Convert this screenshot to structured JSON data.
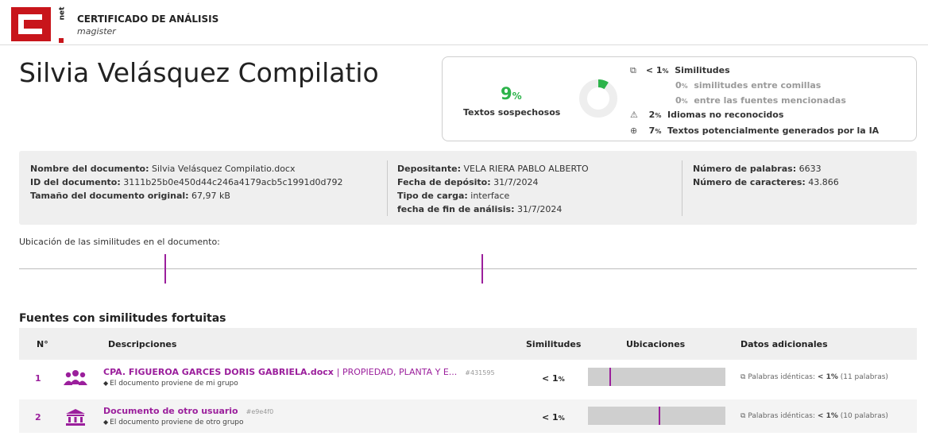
{
  "header": {
    "logo_text": "net",
    "title": "CERTIFICADO DE ANÁLISIS",
    "subtitle": "magister"
  },
  "author": "Silvia Velásquez Compilatio",
  "summary": {
    "suspicious_value": "9",
    "suspicious_unit": "%",
    "suspicious_label": "Textos sospechosos",
    "donut_fraction": 0.09,
    "donut_color": "#2cb34a",
    "rows": [
      {
        "icon": "copy-icon",
        "value": "< 1",
        "unit": "%",
        "label": "Similitudes"
      },
      {
        "icon": "",
        "value": "0",
        "unit": "%",
        "label": "similitudes entre comillas"
      },
      {
        "icon": "",
        "value": "0",
        "unit": "%",
        "label": "entre las fuentes mencionadas"
      },
      {
        "icon": "warning-icon",
        "value": "2",
        "unit": "%",
        "label": "Idiomas no reconocidos"
      },
      {
        "icon": "ai-icon",
        "value": "7",
        "unit": "%",
        "label": "Textos potencialmente generados por la IA"
      }
    ]
  },
  "document_info": {
    "col1": [
      {
        "label": "Nombre del documento:",
        "value": "Silvia Velásquez Compilatio.docx"
      },
      {
        "label": "ID del documento:",
        "value": "3111b25b0e450d44c246a4179acb5c1991d0d792"
      },
      {
        "label": "Tamaño del documento original:",
        "value": "67,97 kB"
      }
    ],
    "col2": [
      {
        "label": "Depositante:",
        "value": "VELA RIERA PABLO ALBERTO"
      },
      {
        "label": "Fecha de depósito:",
        "value": "31/7/2024"
      },
      {
        "label": "Tipo de carga:",
        "value": "interface"
      },
      {
        "label": "fecha de fin de análisis:",
        "value": "31/7/2024"
      }
    ],
    "col3": [
      {
        "label": "Número de palabras:",
        "value": "6633"
      },
      {
        "label": "Número de caracteres:",
        "value": "43.866"
      }
    ]
  },
  "location": {
    "title": "Ubicación de las similitudes en el documento:",
    "accent": "#9b1f9c"
  },
  "sources": {
    "title": "Fuentes con similitudes fortuitas",
    "headers": {
      "num": "N°",
      "desc": "Descripciones",
      "sim": "Similitudes",
      "loc": "Ubicaciones",
      "extra": "Datos adicionales"
    },
    "rows": [
      {
        "num": "1",
        "icon": "group-icon",
        "title": "CPA. FIGUEROA GARCES DORIS GABRIELA.docx",
        "title_extra": "| PROPIEDAD, PLANTA Y E...",
        "hash": "#431595",
        "sub": "El documento proviene de mi grupo",
        "sim_value": "< 1",
        "sim_unit": "%",
        "extra_label": "Palabras idénticas:",
        "extra_value": "< 1%",
        "extra_detail": "(11 palabras)"
      },
      {
        "num": "2",
        "icon": "institution-icon",
        "title": "Documento de otro usuario",
        "title_extra": "",
        "hash": "#e9e4f0",
        "sub": "El documento proviene de otro grupo",
        "sim_value": "< 1",
        "sim_unit": "%",
        "extra_label": "Palabras idénticas:",
        "extra_value": "< 1%",
        "extra_detail": "(10 palabras)"
      }
    ]
  }
}
